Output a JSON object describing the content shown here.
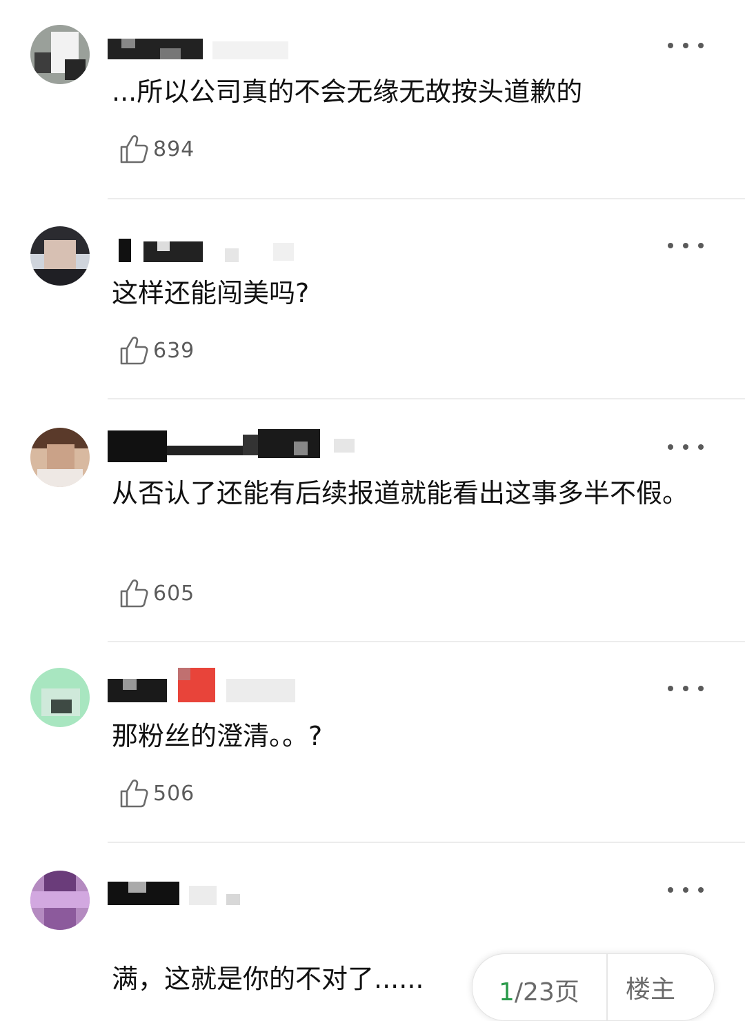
{
  "comments": [
    {
      "text": "...所以公司真的不会无缘无故按头道歉的",
      "likes": "894"
    },
    {
      "text": "这样还能闯美吗?",
      "likes": "639"
    },
    {
      "text": "从否认了还能有后续报道就能看出这事多半不假。",
      "likes": "605"
    },
    {
      "text": "那粉丝的澄清。。?",
      "likes": "506"
    },
    {
      "text": "满，这就是你的不对了......",
      "likes": ""
    }
  ],
  "pager": {
    "current": "1",
    "total": "/23",
    "unit": "页",
    "floor_label": "楼主"
  },
  "icons": {
    "like": "thumbs-up-icon",
    "more": "more-dots-icon"
  },
  "colors": {
    "page_current": "#2a9a4a",
    "like_count": "#5b5b5b",
    "divider": "#ececec"
  }
}
